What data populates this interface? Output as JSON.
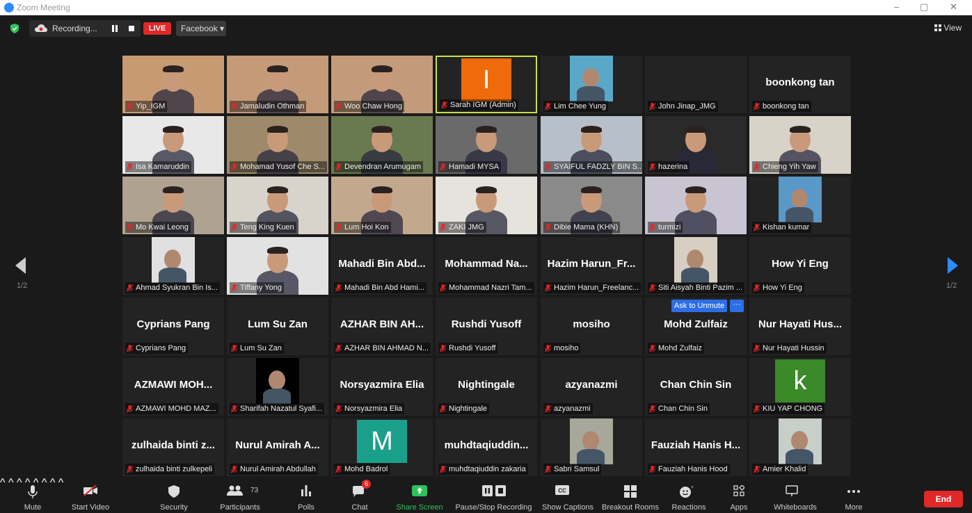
{
  "window": {
    "title": "Zoom Meeting",
    "controls": [
      "–",
      "▢",
      "✕"
    ]
  },
  "topbar": {
    "recording_label": "Recording...",
    "live_label": "LIVE",
    "stream_target": "Facebook ▾",
    "view_label": "View"
  },
  "pagination": {
    "left": "1/2",
    "right": "1/2"
  },
  "ask_to_unmute": "Ask to Unmute",
  "more_dots": "···",
  "tiles": [
    {
      "name": "Yip_IGM",
      "type": "video",
      "bg": "#c89a73"
    },
    {
      "name": "Jamaludin Othman",
      "type": "video",
      "bg": "#c49a78"
    },
    {
      "name": "Woo Chaw Hong",
      "type": "video",
      "bg": "#c39b7a"
    },
    {
      "name": "Sarah IGM (Admin)",
      "type": "avatar",
      "avatar_letter": "I",
      "avatar_color": "#ee6a0a",
      "active": true
    },
    {
      "name": "Lim Chee Yung",
      "type": "photo",
      "bg": "#5aa8c8"
    },
    {
      "name": "John Jinap_JMG",
      "type": "name"
    },
    {
      "name": "boonkong tan",
      "type": "name",
      "display": "boonkong tan"
    },
    {
      "name": "Isa Kamaruddin",
      "type": "video",
      "bg": "#e8e8e8"
    },
    {
      "name": "Mohamad Yusof Che S...",
      "type": "video",
      "bg": "#9e8a6a"
    },
    {
      "name": "Devendran Arumugam",
      "type": "video",
      "bg": "#6a7a50"
    },
    {
      "name": "Hamadi MYSA",
      "type": "video",
      "bg": "#6a6a6a"
    },
    {
      "name": "SYAIFUL FADZLY BIN S...",
      "type": "video",
      "bg": "#b7c0c8"
    },
    {
      "name": "hazerina",
      "type": "video",
      "bg": "#2a2a2a"
    },
    {
      "name": "Chieng Yih Yaw",
      "type": "video",
      "bg": "#d9d2c8"
    },
    {
      "name": "Mo Kwai Leong",
      "type": "video",
      "bg": "#b0a290"
    },
    {
      "name": "Teng King Kuen",
      "type": "video",
      "bg": "#d8d4cc"
    },
    {
      "name": "Lum Hoi Kon",
      "type": "video",
      "bg": "#c2a98e"
    },
    {
      "name": "ZAKI JMG",
      "type": "video",
      "bg": "#e6e2dc"
    },
    {
      "name": "Dibie Mama (KHN)",
      "type": "video",
      "bg": "#8a8a8a"
    },
    {
      "name": "turmizi",
      "type": "video",
      "bg": "#c9c4d2"
    },
    {
      "name": "Kishan kumar",
      "type": "photo",
      "bg": "#5a98c8"
    },
    {
      "name": "Ahmad Syukran Bin Is...",
      "type": "photo",
      "bg": "#e0e0e0"
    },
    {
      "name": "Tiffany Yong",
      "type": "video",
      "bg": "#e2e2e2"
    },
    {
      "name": "Mahadi Bin Abd Hami...",
      "type": "name",
      "display": "Mahadi Bin Abd..."
    },
    {
      "name": "Mohammad Nazri Tam...",
      "type": "name",
      "display": "Mohammad Na..."
    },
    {
      "name": "Hazim Harun_Freelanc...",
      "type": "name",
      "display": "Hazim Harun_Fr..."
    },
    {
      "name": "Siti Aisyah Binti Pazim ...",
      "type": "photo",
      "bg": "#d8cfc4"
    },
    {
      "name": "How Yi Eng",
      "type": "name",
      "display": "How Yi Eng"
    },
    {
      "name": "Cyprians Pang",
      "type": "name",
      "display": "Cyprians Pang"
    },
    {
      "name": "Lum Su Zan",
      "type": "name",
      "display": "Lum Su Zan"
    },
    {
      "name": "AZHAR BIN AHMAD N...",
      "type": "name",
      "display": "AZHAR BIN AH..."
    },
    {
      "name": "Rushdi Yusoff",
      "type": "name",
      "display": "Rushdi Yusoff"
    },
    {
      "name": "mosiho",
      "type": "name",
      "display": "mosiho"
    },
    {
      "name": "Mohd Zulfaiz",
      "type": "name",
      "display": "Mohd Zulfaiz"
    },
    {
      "name": "Nur Hayati Hussin",
      "type": "name",
      "display": "Nur Hayati Hus..."
    },
    {
      "name": "AZMAWI MOHD MAZ...",
      "type": "name",
      "display": "AZMAWI MOH..."
    },
    {
      "name": "Sharifah Nazatul Syafi...",
      "type": "photo",
      "bg": "#000000"
    },
    {
      "name": "Norsyazmira Elia",
      "type": "name",
      "display": "Norsyazmira Elia"
    },
    {
      "name": "Nightingale",
      "type": "name",
      "display": "Nightingale"
    },
    {
      "name": "azyanazmi",
      "type": "name",
      "display": "azyanazmi"
    },
    {
      "name": "Chan Chin Sin",
      "type": "name",
      "display": "Chan Chin Sin"
    },
    {
      "name": "KIU YAP CHONG",
      "type": "avatar",
      "avatar_letter": "k",
      "avatar_color": "#3a8a2a"
    },
    {
      "name": "zulhaida binti zulkepeli",
      "type": "name",
      "display": "zulhaida binti z..."
    },
    {
      "name": "Nurul Amirah Abdullah",
      "type": "name",
      "display": "Nurul Amirah A..."
    },
    {
      "name": "Mohd Badrol",
      "type": "avatar",
      "avatar_letter": "M",
      "avatar_color": "#1aa08a"
    },
    {
      "name": "muhdtaqiuddin zakaria",
      "type": "name",
      "display": "muhdtaqiuddin..."
    },
    {
      "name": "Sabri Samsul",
      "type": "photo",
      "bg": "#a8a89a"
    },
    {
      "name": "Fauziah Hanis Hood",
      "type": "name",
      "display": "Fauziah Hanis H..."
    },
    {
      "name": "Amier Khalid",
      "type": "photo",
      "bg": "#c8cfc8"
    }
  ],
  "toolbar": {
    "mute": "Mute",
    "start_video": "Start Video",
    "security": "Security",
    "participants": "Participants",
    "participants_count": "73",
    "polls": "Polls",
    "chat": "Chat",
    "chat_badge": "6",
    "share_screen": "Share Screen",
    "pause_stop_recording": "Pause/Stop Recording",
    "show_captions": "Show Captions",
    "breakout_rooms": "Breakout Rooms",
    "reactions": "Reactions",
    "apps": "Apps",
    "whiteboards": "Whiteboards",
    "more": "More",
    "end": "End"
  },
  "colors": {
    "accent": "#2d8cff",
    "end": "#e02828",
    "active_border": "#c6e24b",
    "share_green": "#2ec15b"
  }
}
